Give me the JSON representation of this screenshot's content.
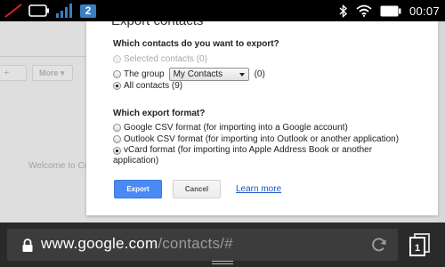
{
  "status_bar": {
    "sim_badge": "2",
    "time": "00:07"
  },
  "background_page": {
    "more_label": "More ▾",
    "add_glyph": "+",
    "welcome_text": "Welcome to Co"
  },
  "dialog": {
    "title": "Export contacts",
    "contacts_question": "Which contacts do you want to export?",
    "contact_options": {
      "selected": "Selected contacts (0)",
      "group_prefix": "The group",
      "group_selected": "My Contacts",
      "group_count": "(0)",
      "all": "All contacts (9)"
    },
    "format_question": "Which export format?",
    "format_options": {
      "google_csv": "Google CSV format (for importing into a Google account)",
      "outlook_csv": "Outlook CSV format (for importing into Outlook or another application)",
      "vcard_line1": "vCard format (for importing into Apple Address Book or another",
      "vcard_line2": "application)"
    },
    "export_label": "Export",
    "cancel_label": "Cancel",
    "learn_more_label": "Learn more"
  },
  "url_bar": {
    "host": "www.google.com",
    "path": "/contacts/#"
  },
  "colors": {
    "primary_button": "#4a8af4",
    "link": "#1a55c6",
    "sim_badge": "#3a7fc4",
    "no_signal_slash": "#e02020"
  }
}
